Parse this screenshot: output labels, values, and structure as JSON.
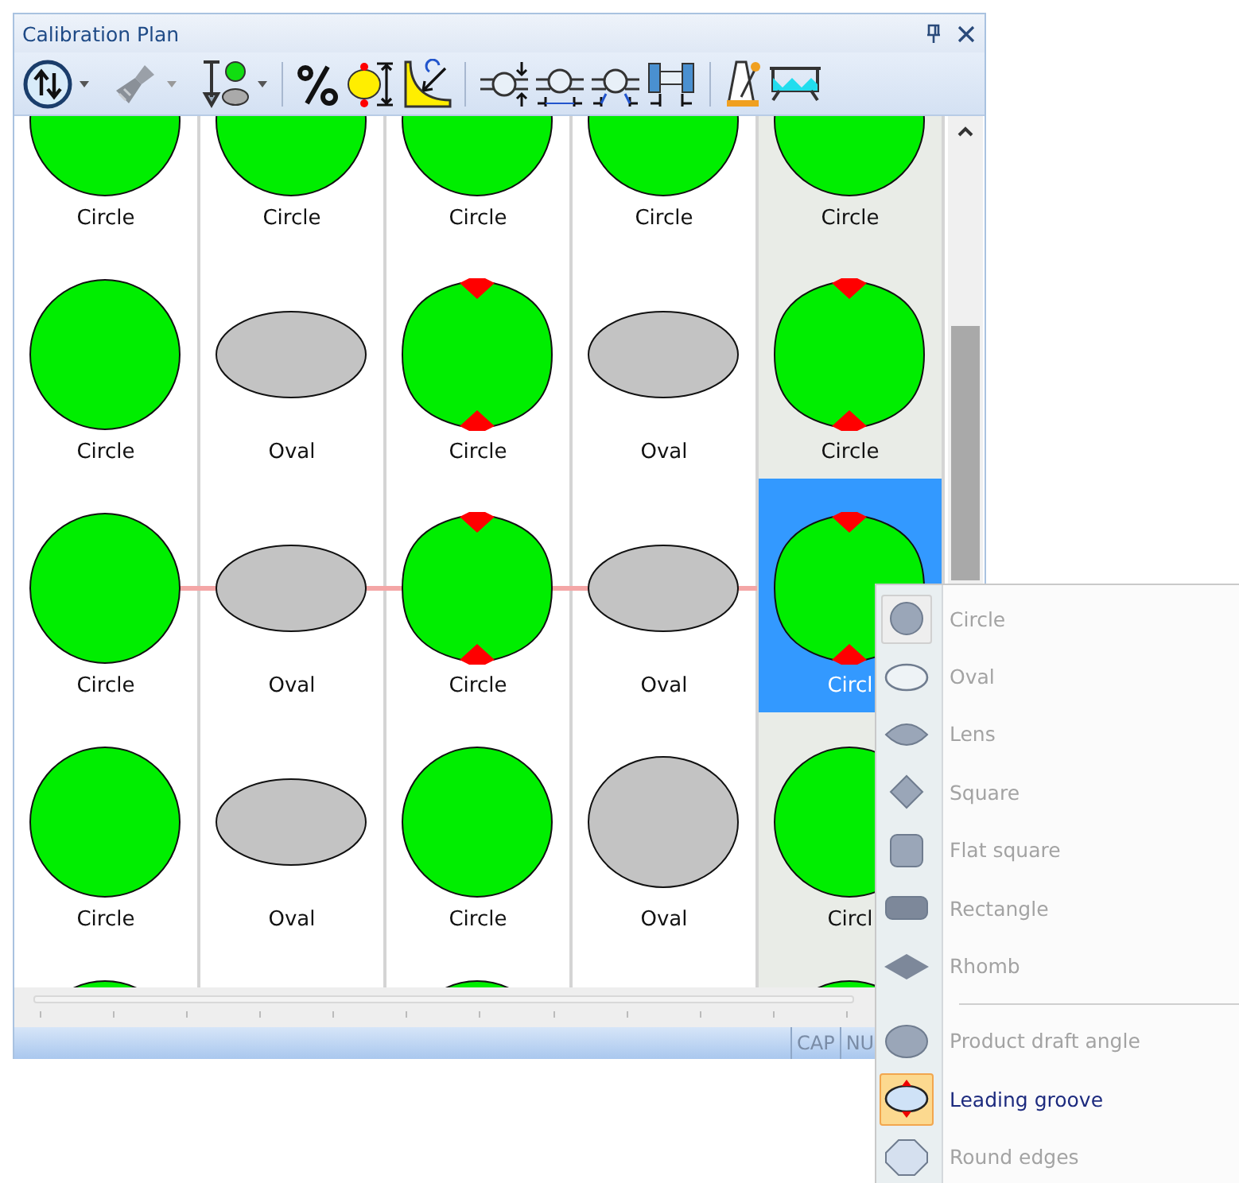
{
  "window": {
    "title": "Calibration Plan"
  },
  "grid": {
    "columns": [
      {
        "shaded": false
      },
      {
        "shaded": false
      },
      {
        "shaded": false
      },
      {
        "shaded": false
      },
      {
        "shaded": true
      }
    ],
    "rows": [
      {
        "linked": false,
        "cells": [
          {
            "kind": "circle",
            "label": "Circle",
            "selected": false
          },
          {
            "kind": "circle",
            "label": "Circle",
            "selected": false
          },
          {
            "kind": "circle",
            "label": "Circle",
            "selected": false
          },
          {
            "kind": "circle",
            "label": "Circle",
            "selected": false
          },
          {
            "kind": "circle",
            "label": "Circle",
            "selected": false
          }
        ]
      },
      {
        "linked": false,
        "cells": [
          {
            "kind": "circle",
            "label": "Circle",
            "selected": false
          },
          {
            "kind": "oval",
            "label": "Oval",
            "selected": false
          },
          {
            "kind": "grooved",
            "label": "Circle",
            "selected": false
          },
          {
            "kind": "oval",
            "label": "Oval",
            "selected": false
          },
          {
            "kind": "grooved",
            "label": "Circle",
            "selected": false
          }
        ]
      },
      {
        "linked": true,
        "cells": [
          {
            "kind": "circle",
            "label": "Circle",
            "selected": false
          },
          {
            "kind": "oval",
            "label": "Oval",
            "selected": false
          },
          {
            "kind": "grooved",
            "label": "Circle",
            "selected": false
          },
          {
            "kind": "oval",
            "label": "Oval",
            "selected": false
          },
          {
            "kind": "grooved",
            "label": "Circl",
            "selected": true
          }
        ]
      },
      {
        "linked": false,
        "cells": [
          {
            "kind": "circle",
            "label": "Circle",
            "selected": false
          },
          {
            "kind": "oval",
            "label": "Oval",
            "selected": false
          },
          {
            "kind": "circle",
            "label": "Circle",
            "selected": false
          },
          {
            "kind": "ellipse",
            "label": "Oval",
            "selected": false
          },
          {
            "kind": "circle",
            "label": "Circl",
            "selected": false
          }
        ]
      },
      {
        "cells": [
          {
            "kind": "circle",
            "selected": false
          },
          {
            "kind": "none"
          },
          {
            "kind": "circle",
            "selected": false
          },
          {
            "kind": "none"
          },
          {
            "kind": "circle",
            "selected": false
          }
        ]
      }
    ]
  },
  "status_bar": [
    "CAP",
    "NU"
  ],
  "menu": {
    "items": [
      {
        "kind": "circle",
        "label": "Circle",
        "checked": true,
        "selected": false
      },
      {
        "kind": "oval",
        "label": "Oval",
        "checked": false,
        "selected": false
      },
      {
        "kind": "lens",
        "label": "Lens",
        "checked": false,
        "selected": false
      },
      {
        "kind": "square",
        "label": "Square",
        "checked": false,
        "selected": false
      },
      {
        "kind": "flat-square",
        "label": "Flat square",
        "checked": false,
        "selected": false
      },
      {
        "kind": "rectangle",
        "label": "Rectangle",
        "checked": false,
        "selected": false
      },
      {
        "kind": "rhomb",
        "label": "Rhomb",
        "checked": false,
        "selected": false
      },
      {
        "kind": "separator"
      },
      {
        "kind": "draft",
        "label": "Product draft angle",
        "checked": false,
        "selected": false
      },
      {
        "kind": "groove",
        "label": "Leading groove",
        "checked": false,
        "selected": true
      },
      {
        "kind": "round-edges",
        "label": "Round edges",
        "checked": false,
        "selected": false
      }
    ]
  }
}
